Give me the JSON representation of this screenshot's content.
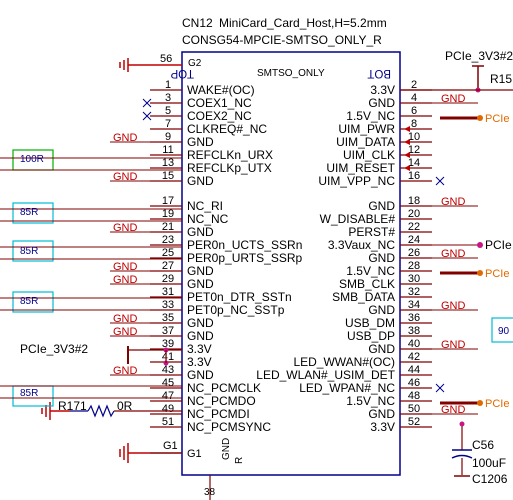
{
  "component": {
    "refdes": "CN12",
    "name": "MiniCard_Card_Host,H=5.2mm",
    "footprint": "CONSG54-MPCIE-SMTSO_ONLY_R",
    "top_label": "TOP",
    "bot_label": "BOT",
    "center_label": "SMTSO_ONLY"
  },
  "left_pins": [
    {
      "num": "56",
      "name": "G2",
      "net": ""
    },
    {
      "num": "1",
      "name": "WAKE#(OC)",
      "net": ""
    },
    {
      "num": "3",
      "name": "COEX1_NC",
      "net": ""
    },
    {
      "num": "5",
      "name": "COEX2_NC",
      "net": ""
    },
    {
      "num": "7",
      "name": "CLKREQ#_NC",
      "net": ""
    },
    {
      "num": "9",
      "name": "GND",
      "net": "GND"
    },
    {
      "num": "11",
      "name": "REFCLKn_URX",
      "net": ""
    },
    {
      "num": "13",
      "name": "REFCLKp_UTX",
      "net": ""
    },
    {
      "num": "15",
      "name": "GND",
      "net": "GND"
    },
    {
      "num": "17",
      "name": "NC_RI",
      "net": ""
    },
    {
      "num": "19",
      "name": "NC_NC",
      "net": ""
    },
    {
      "num": "21",
      "name": "GND",
      "net": "GND"
    },
    {
      "num": "23",
      "name": "PER0n_UCTS_SSRn",
      "net": ""
    },
    {
      "num": "25",
      "name": "PER0p_URTS_SSRp",
      "net": ""
    },
    {
      "num": "27",
      "name": "GND",
      "net": "GND"
    },
    {
      "num": "29",
      "name": "GND",
      "net": "GND"
    },
    {
      "num": "31",
      "name": "PET0n_DTR_SSTn",
      "net": ""
    },
    {
      "num": "33",
      "name": "PET0p_NC_SSTp",
      "net": ""
    },
    {
      "num": "35",
      "name": "GND",
      "net": "GND"
    },
    {
      "num": "37",
      "name": "GND",
      "net": "GND"
    },
    {
      "num": "39",
      "name": "3.3V",
      "net": ""
    },
    {
      "num": "41",
      "name": "3.3V",
      "net": ""
    },
    {
      "num": "43",
      "name": "GND",
      "net": "GND"
    },
    {
      "num": "45",
      "name": "NC_PCMCLK",
      "net": ""
    },
    {
      "num": "47",
      "name": "NC_PCMDO",
      "net": ""
    },
    {
      "num": "49",
      "name": "NC_PCMDI",
      "net": ""
    },
    {
      "num": "51",
      "name": "NC_PCMSYNC",
      "net": ""
    },
    {
      "num": "G1",
      "name": "G1",
      "net": ""
    }
  ],
  "right_pins": [
    {
      "num": "2",
      "name": "3.3V",
      "net": ""
    },
    {
      "num": "4",
      "name": "GND",
      "net": "GND"
    },
    {
      "num": "6",
      "name": "1.5V_NC",
      "net": ""
    },
    {
      "num": "8",
      "name": "UIM_PWR",
      "net": ""
    },
    {
      "num": "10",
      "name": "UIM_DATA",
      "net": ""
    },
    {
      "num": "12",
      "name": "UIM_CLK",
      "net": ""
    },
    {
      "num": "14",
      "name": "UIM_RESET",
      "net": ""
    },
    {
      "num": "16",
      "name": "UIM_VPP_NC",
      "net": ""
    },
    {
      "num": "18",
      "name": "GND",
      "net": "GND"
    },
    {
      "num": "20",
      "name": "W_DISABLE#",
      "net": ""
    },
    {
      "num": "22",
      "name": "PERST#",
      "net": ""
    },
    {
      "num": "24",
      "name": "3.3Vaux_NC",
      "net": ""
    },
    {
      "num": "26",
      "name": "GND",
      "net": "GND"
    },
    {
      "num": "28",
      "name": "1.5V_NC",
      "net": ""
    },
    {
      "num": "30",
      "name": "SMB_CLK",
      "net": ""
    },
    {
      "num": "32",
      "name": "SMB_DATA",
      "net": ""
    },
    {
      "num": "34",
      "name": "GND",
      "net": "GND"
    },
    {
      "num": "36",
      "name": "USB_DM",
      "net": ""
    },
    {
      "num": "38",
      "name": "USB_DP",
      "net": ""
    },
    {
      "num": "40",
      "name": "GND",
      "net": "GND"
    },
    {
      "num": "42",
      "name": "LED_WWAN#(OC)",
      "net": ""
    },
    {
      "num": "44",
      "name": "LED_WLAN#_USIM_DET",
      "net": ""
    },
    {
      "num": "46",
      "name": "LED_WPAN#_NC",
      "net": ""
    },
    {
      "num": "48",
      "name": "1.5V_NC",
      "net": ""
    },
    {
      "num": "50",
      "name": "GND",
      "net": "GND"
    },
    {
      "num": "52",
      "name": "3.3V",
      "net": ""
    }
  ],
  "gnd_net_label": "GND",
  "pcie_3v3_top": "PCIe_3V3#2",
  "pcie_3v3_left": "PCIe_3V3#2",
  "pcie_partial": [
    "PCIe",
    "PCIe",
    "PCIe",
    "PCIe"
  ],
  "r15_label": "R15",
  "r171": {
    "refdes": "R171",
    "value": "0R"
  },
  "cap": {
    "refdes": "C56",
    "value": "100uF",
    "package": "C1206"
  },
  "left_resistor_labels": [
    "100R",
    "85R",
    "85R",
    "85R",
    "85R"
  ],
  "right_partial_box": "90",
  "pin_bottom": "38",
  "g1_labels": {
    "gnd": "GND",
    "r": "R"
  },
  "colors": {
    "body": "#00008b",
    "ground": "#c00000",
    "wire": "#800000",
    "pcie": "#e06a00",
    "connector": "#008000",
    "resistor_cyan": "#00bcd4"
  }
}
